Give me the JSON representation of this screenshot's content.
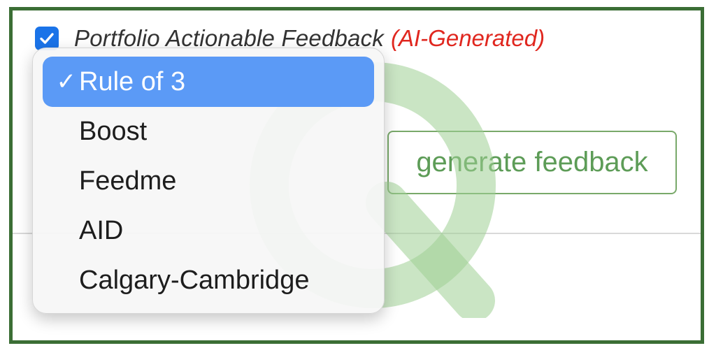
{
  "header": {
    "checkbox_checked": true,
    "title": "Portfolio Actionable Feedback",
    "ai_tag": "(AI-Generated)"
  },
  "dropdown": {
    "selected_mark": "✓",
    "items": [
      {
        "label": "Rule of 3",
        "selected": true
      },
      {
        "label": "Boost",
        "selected": false
      },
      {
        "label": "Feedme",
        "selected": false
      },
      {
        "label": "AID",
        "selected": false
      },
      {
        "label": "Calgary-Cambridge",
        "selected": false
      }
    ]
  },
  "actions": {
    "generate_label": "generate feedback"
  },
  "colors": {
    "frame_border": "#3b6e35",
    "checkbox": "#1a73e8",
    "ai_tag": "#e0271f",
    "selected_item": "#5b9af6",
    "button_text": "#5d9c57",
    "watermark": "#9fcf93"
  }
}
